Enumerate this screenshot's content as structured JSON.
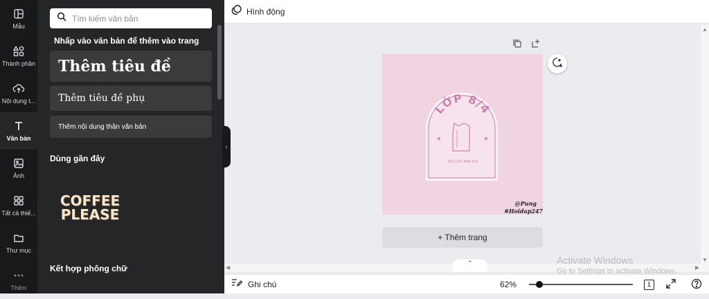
{
  "rail": [
    {
      "label": "Mẫu",
      "icon": "template-icon"
    },
    {
      "label": "Thành phần",
      "icon": "elements-icon"
    },
    {
      "label": "Nội dung t...",
      "icon": "upload-cloud-icon"
    },
    {
      "label": "Văn bản",
      "icon": "text-icon",
      "active": true
    },
    {
      "label": "Ảnh",
      "icon": "image-icon"
    },
    {
      "label": "Tất cả thiế...",
      "icon": "grid-icon"
    },
    {
      "label": "Thư mục",
      "icon": "folder-icon"
    },
    {
      "label": "Thêm",
      "icon": "more-icon"
    }
  ],
  "panel": {
    "search_placeholder": "Tìm kiếm văn bản",
    "hint": "Nhấp vào văn bản để thêm vào trang",
    "heading_btn": "Thêm tiêu đề",
    "subheading_btn": "Thêm tiêu đề phụ",
    "body_btn": "Thêm nội dung thân văn bản",
    "recent_title": "Dùng gần đây",
    "recent_item": "COFFEE PLEASE",
    "combos_title": "Kết hợp phông chữ"
  },
  "topbar": {
    "animate_label": "Hình động"
  },
  "design": {
    "arch_title": "LỚP 8/4",
    "arch_small": "YÊU CÁC BẠN 8/4",
    "credit1": "@Pung",
    "credit2": "#Hoidap247",
    "bg": "#f1d4e2",
    "accent": "#c985b0"
  },
  "canvas": {
    "add_page": "+ Thêm trang"
  },
  "bottombar": {
    "notes": "Ghi chú",
    "zoom": "62%",
    "zoom_fraction": 0.1,
    "page_count": "1"
  },
  "watermark": {
    "line1": "Activate Windows",
    "line2": "Go to Settings to activate Windows."
  }
}
